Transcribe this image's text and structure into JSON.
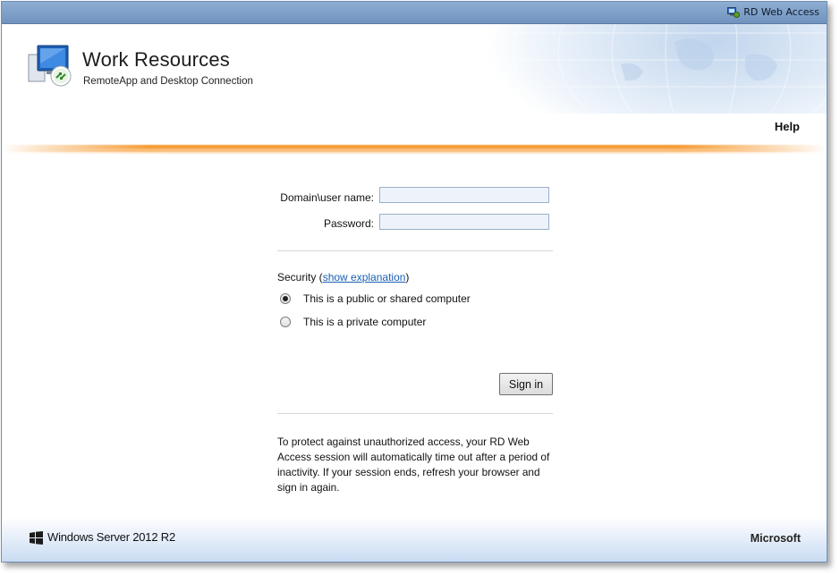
{
  "topbar": {
    "brand_label": "RD Web Access",
    "brand_icon": "rd-web-access-icon"
  },
  "header": {
    "title": "Work Resources",
    "subtitle": "RemoteApp and Desktop Connection",
    "help_label": "Help",
    "logo_icon": "remote-desktop-icon"
  },
  "login": {
    "username_label": "Domain\\user name:",
    "username_value": "",
    "password_label": "Password:",
    "password_value": ""
  },
  "security": {
    "label_prefix": "Security (",
    "link_label": "show explanation",
    "label_suffix": ")",
    "options": [
      {
        "label": "This is a public or shared computer",
        "checked": true
      },
      {
        "label": "This is a private computer",
        "checked": false
      }
    ]
  },
  "signin_label": "Sign in",
  "notice": "To protect against unauthorized access, your RD Web Access session will automatically time out after a period of inactivity. If your session ends, refresh your browser and sign in again.",
  "footer": {
    "product": "Windows Server 2012 R2",
    "company": "Microsoft",
    "windows_icon": "windows-logo-icon"
  },
  "colors": {
    "accent_orange": "#f59b34",
    "topbar_blue": "#7f9fc8",
    "link_blue": "#1a5fb4"
  }
}
